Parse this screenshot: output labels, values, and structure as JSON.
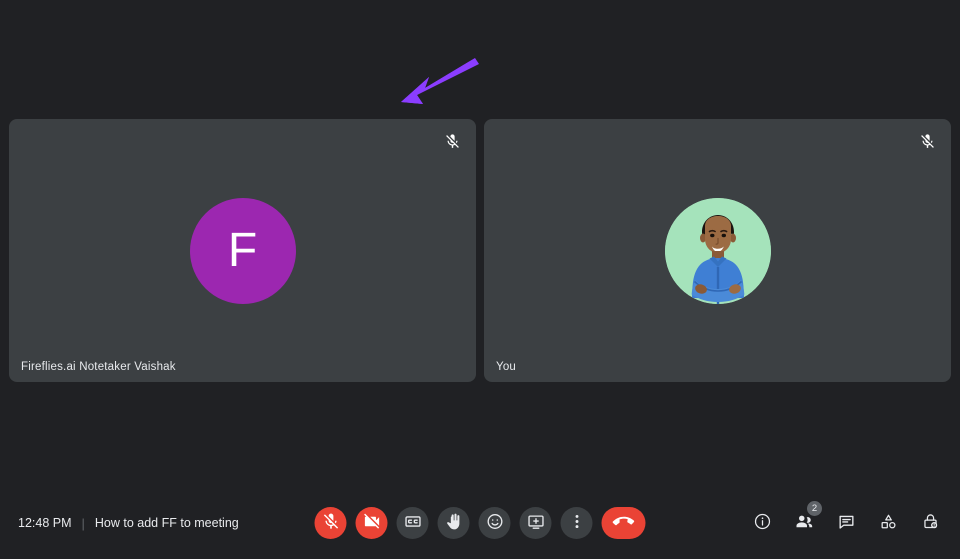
{
  "meeting": {
    "time": "12:48 PM",
    "divider": "|",
    "name": "How to add FF to meeting"
  },
  "colors": {
    "background": "#202124",
    "tile": "#3c4043",
    "danger": "#ea4335",
    "avatar_purple": "#9c27b0",
    "avatar_photo_bg": "#a5e3bb",
    "arrow_purple": "#8b3dff",
    "badge": "#5f6368"
  },
  "tiles": [
    {
      "name": "Fireflies.ai Notetaker Vaishak",
      "avatar_type": "initial",
      "initial": "F",
      "avatar_color": "#9c27b0",
      "muted": true,
      "mute_icon": "mic-off-icon"
    },
    {
      "name": "You",
      "avatar_type": "photo",
      "initial": "",
      "avatar_color": "#a5e3bb",
      "muted": true,
      "mute_icon": "mic-off-icon"
    }
  ],
  "annotation": {
    "type": "arrow",
    "color": "#8b3dff",
    "direction": "down-left"
  },
  "controls": {
    "center": [
      {
        "name": "microphone",
        "label": "Turn on microphone",
        "icon": "mic-off-icon",
        "state": "off",
        "style": "danger"
      },
      {
        "name": "camera",
        "label": "Turn on camera",
        "icon": "video-off-icon",
        "state": "off",
        "style": "danger"
      },
      {
        "name": "captions",
        "label": "Turn on captions",
        "icon": "closed-caption-icon",
        "state": "default",
        "style": "normal"
      },
      {
        "name": "raise-hand",
        "label": "Raise hand",
        "icon": "raise-hand-icon",
        "state": "default",
        "style": "normal"
      },
      {
        "name": "reactions",
        "label": "Send a reaction",
        "icon": "emoji-icon",
        "state": "default",
        "style": "normal"
      },
      {
        "name": "present",
        "label": "Present now",
        "icon": "present-screen-icon",
        "state": "default",
        "style": "normal"
      },
      {
        "name": "more-options",
        "label": "More options",
        "icon": "more-vertical-icon",
        "state": "default",
        "style": "normal"
      },
      {
        "name": "end-call",
        "label": "Leave call",
        "icon": "end-call-icon",
        "state": "default",
        "style": "endcall"
      }
    ],
    "right": [
      {
        "name": "meeting-details",
        "label": "Meeting details",
        "icon": "info-icon",
        "badge": ""
      },
      {
        "name": "people",
        "label": "People",
        "icon": "people-icon",
        "badge": "2"
      },
      {
        "name": "chat",
        "label": "Chat with everyone",
        "icon": "chat-icon",
        "badge": ""
      },
      {
        "name": "activities",
        "label": "Activities",
        "icon": "activities-icon",
        "badge": ""
      },
      {
        "name": "host-controls",
        "label": "Host controls",
        "icon": "lock-icon",
        "badge": ""
      }
    ]
  }
}
